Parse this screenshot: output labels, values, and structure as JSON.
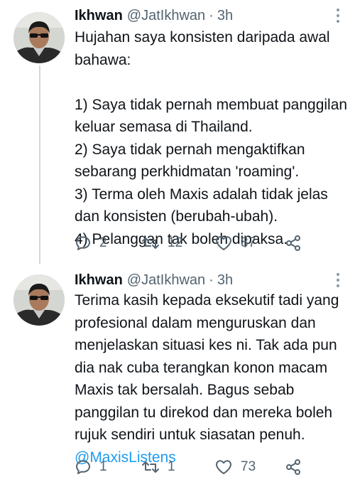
{
  "tweets": [
    {
      "name": "Ikhwan",
      "handle": "@JatIkhwan",
      "separator": "·",
      "time": "3h",
      "lines": [
        "Hujahan saya konsisten daripada awal",
        "bahawa:",
        "",
        "1) Saya tidak pernah membuat panggilan",
        "keluar semasa di Thailand.",
        "2) Saya tidak pernah mengaktifkan",
        "sebarang perkhidmatan 'roaming'.",
        "3) Terma oleh Maxis adalah tidak jelas",
        "dan konsisten (berubah-ubah).",
        "4) Pelanggan tak boleh dipaksa."
      ],
      "replies": "2",
      "retweets": "12",
      "likes": "87"
    },
    {
      "name": "Ikhwan",
      "handle": "@JatIkhwan",
      "separator": "·",
      "time": "3h",
      "lines": [
        "Terima kasih kepada eksekutif tadi yang",
        "profesional dalam menguruskan dan",
        "menjelaskan situasi kes ni. Tak ada pun",
        "dia nak cuba terangkan konon macam",
        "Maxis tak bersalah. Bagus sebab",
        "panggilan tu direkod dan mereka boleh",
        "rujuk sendiri untuk siasatan penuh."
      ],
      "mention": "@MaxisListens",
      "replies": "1",
      "retweets": "1",
      "likes": "73"
    }
  ],
  "colors": {
    "text": "#0f1419",
    "secondary": "#536471",
    "link": "#1d9bf0",
    "thread": "#cfd9de"
  },
  "icons": [
    "reply-icon",
    "retweet-icon",
    "like-icon",
    "share-icon",
    "more-icon"
  ]
}
